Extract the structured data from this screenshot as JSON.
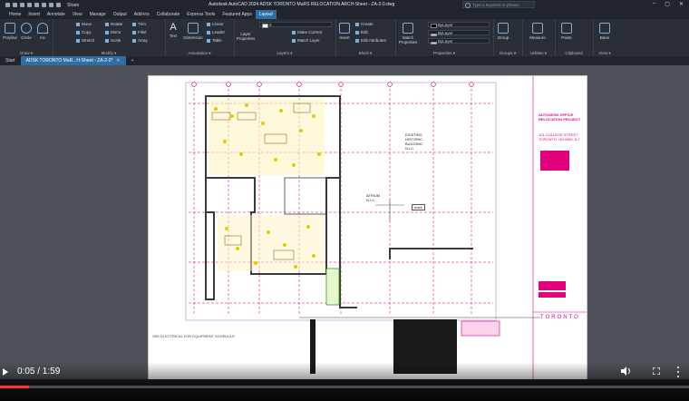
{
  "app_title": "Autodesk AutoCAD 2024   ADSK TORONTO MaRS RELOCATION ARCH-Sheet - ZA-2-0.dwg",
  "quick_access": {
    "share_label": "Share"
  },
  "search": {
    "placeholder": "Type a keyword or phrase"
  },
  "window_controls": {
    "minimize": "–",
    "maximize": "▢",
    "close": "✕"
  },
  "menu_tabs": [
    "Home",
    "Insert",
    "Annotate",
    "View",
    "Manage",
    "Output",
    "Add-ins",
    "Collaborate",
    "Express Tools",
    "Featured Apps",
    "Layout"
  ],
  "active_menu_tab": "Layout",
  "ribbon": {
    "draw": {
      "label": "Draw ▾",
      "polyline": "Polyline",
      "circle": "Circle",
      "arc": "Arc"
    },
    "modify": {
      "label": "Modify ▾",
      "move": "Move",
      "rotate": "Rotate",
      "trim": "Trim",
      "copy": "Copy",
      "mirror": "Mirror",
      "fillet": "Fillet",
      "stretch": "Stretch",
      "scale": "Scale",
      "array": "Array"
    },
    "annotation": {
      "label": "Annotation ▾",
      "text": "Text",
      "dimension": "Dimension",
      "linear": "Linear",
      "leader": "Leader",
      "table": "Table"
    },
    "layers": {
      "label": "Layers ▾",
      "layer_properties": "Layer Properties",
      "make_current": "Make Current",
      "match_layer": "Match Layer",
      "layer_value": "0"
    },
    "block": {
      "label": "Block ▾",
      "insert": "Insert",
      "create": "Create",
      "edit": "Edit",
      "edit_attributes": "Edit Attributes"
    },
    "properties": {
      "label": "Properties ▾",
      "match_properties": "Match Properties",
      "bylayer_1": "ByLayer",
      "bylayer_2": "ByLayer",
      "bylayer_3": "ByLayer"
    },
    "groups": {
      "label": "Groups ▾",
      "group": "Group"
    },
    "utilities": {
      "label": "Utilities ▾",
      "measure": "Measure"
    },
    "clipboard": {
      "label": "Clipboard",
      "paste": "Paste"
    },
    "view": {
      "label": "View ▾",
      "base": "Base"
    }
  },
  "doc_tabs": [
    {
      "label": "Start",
      "active": false
    },
    {
      "label": "ADSK TORONTO MaR...H-Sheet - ZA-2-0*",
      "active": true
    }
  ],
  "new_tab_label": "+",
  "drawing": {
    "existing_building": [
      "EXISTING",
      "HISTORIC",
      "BUILDING",
      "N.I.C."
    ],
    "atrium": [
      "ATRIUM",
      "N.I.C."
    ],
    "small_label": "mark",
    "schedule_title": "SEE ELECTRICAL FOR EQUIPMENT SCHEDULE",
    "titleblock_project": [
      "AUTODESK OFFICE",
      "RELOCATION PROJECT"
    ],
    "titleblock_address": [
      "101 COLLEGE STREET",
      "TORONTO, ON M5G 1L7"
    ],
    "titleblock_city": "TORONTO"
  },
  "video": {
    "time": "0:05 / 1:59",
    "progress": 0.042
  },
  "colors": {
    "accent": "#2e6ea6",
    "titleblock_magenta": "#e3007d",
    "progress_red": "#ff3434"
  }
}
